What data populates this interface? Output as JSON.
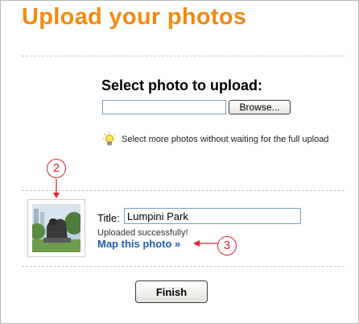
{
  "page": {
    "title": "Upload your photos",
    "accent_color": "#f28a12",
    "link_color": "#1f5fae",
    "callout_color": "#e0232e"
  },
  "upload": {
    "heading": "Select photo to upload:",
    "file_value": "",
    "browse_label": "Browse...",
    "tip_icon": "lightbulb-icon",
    "tip_text": "Select more photos without waiting for the full upload"
  },
  "photo": {
    "thumbnail_icon": "photo-thumbnail",
    "title_label": "Title:",
    "title_value": "Lumpini Park",
    "status": "Uploaded successfully!",
    "map_link": "Map this photo »"
  },
  "callouts": {
    "thumbnail": "2",
    "map_link": "3"
  },
  "footer": {
    "finish_label": "Finish"
  }
}
